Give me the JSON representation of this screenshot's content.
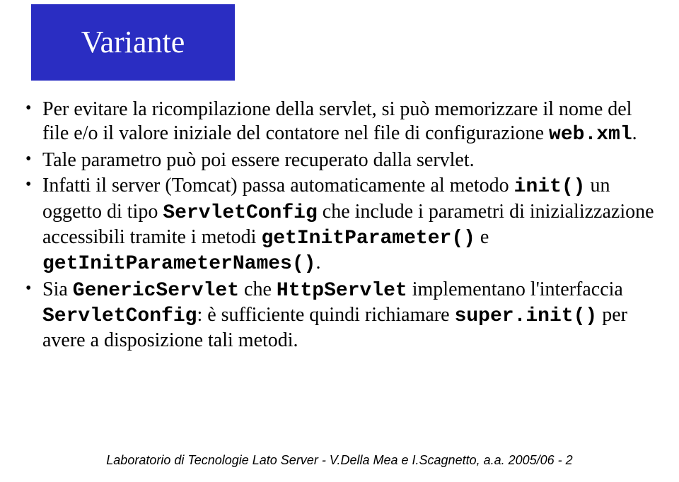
{
  "title": "Variante",
  "bullets": [
    {
      "segments": [
        {
          "t": "Per evitare la ricompilazione della servlet, si può memorizzare il nome del file e/o il valore iniziale del contatore nel file di configurazione "
        },
        {
          "t": "web.xml",
          "mono": true
        },
        {
          "t": "."
        }
      ]
    },
    {
      "segments": [
        {
          "t": "Tale parametro può poi essere recuperato dalla servlet."
        }
      ]
    },
    {
      "segments": [
        {
          "t": "Infatti il server (Tomcat) passa automaticamente al metodo "
        },
        {
          "t": "init()",
          "mono": true
        },
        {
          "t": " un oggetto di tipo "
        },
        {
          "t": "ServletConfig",
          "mono": true
        },
        {
          "t": " che include i parametri di inizializzazione accessibili tramite i metodi "
        },
        {
          "t": "getInitParameter()",
          "mono": true
        },
        {
          "t": " e "
        },
        {
          "t": "getInitParameterNames()",
          "mono": true
        },
        {
          "t": "."
        }
      ]
    },
    {
      "segments": [
        {
          "t": "Sia "
        },
        {
          "t": "GenericServlet",
          "mono": true
        },
        {
          "t": " che "
        },
        {
          "t": "HttpServlet",
          "mono": true
        },
        {
          "t": " implementano l'interfaccia "
        },
        {
          "t": "ServletConfig",
          "mono": true
        },
        {
          "t": ": è sufficiente quindi richiamare "
        },
        {
          "t": "super.init()",
          "mono": true
        },
        {
          "t": " per avere a disposizione tali metodi."
        }
      ]
    }
  ],
  "footer": "Laboratorio di Tecnologie Lato Server - V.Della Mea e I.Scagnetto, a.a. 2005/06 - 2"
}
